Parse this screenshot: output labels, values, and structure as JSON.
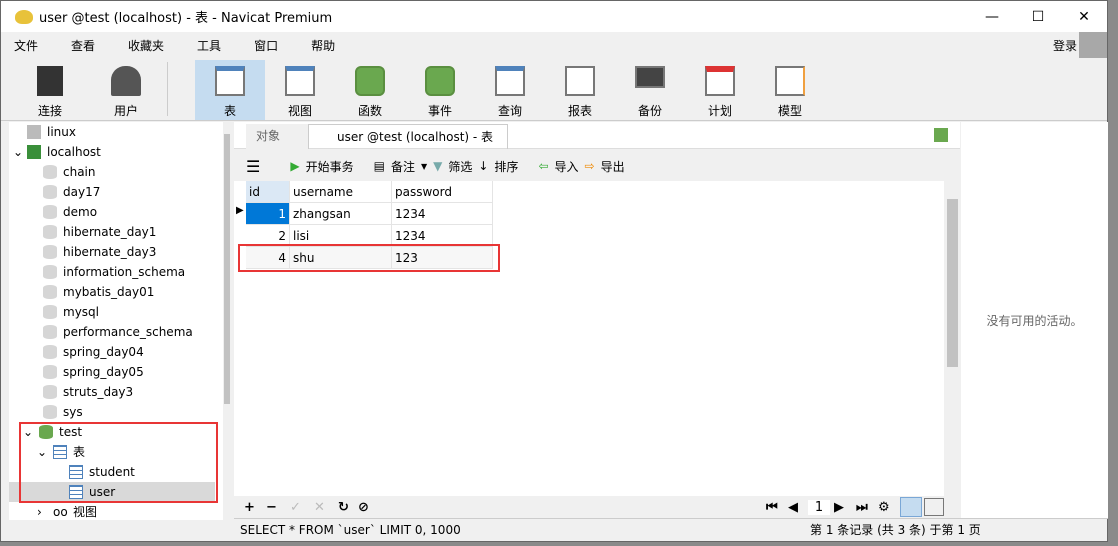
{
  "window": {
    "title": "user @test (localhost) - 表 - Navicat Premium",
    "minimize": "—",
    "maximize": "☐",
    "close": "✕"
  },
  "menu": [
    "文件",
    "查看",
    "收藏夹",
    "工具",
    "窗口",
    "帮助"
  ],
  "login": "登录",
  "toolbar": [
    {
      "label": "连接",
      "icon": "connection-icon"
    },
    {
      "label": "用户",
      "icon": "user-icon"
    },
    {
      "label": "表",
      "icon": "table-icon",
      "selected": true
    },
    {
      "label": "视图",
      "icon": "view-icon"
    },
    {
      "label": "函数",
      "icon": "function-icon"
    },
    {
      "label": "事件",
      "icon": "event-icon"
    },
    {
      "label": "查询",
      "icon": "query-icon"
    },
    {
      "label": "报表",
      "icon": "report-icon"
    },
    {
      "label": "备份",
      "icon": "backup-icon"
    },
    {
      "label": "计划",
      "icon": "schedule-icon"
    },
    {
      "label": "模型",
      "icon": "model-icon"
    }
  ],
  "tree": {
    "connections": [
      "linux",
      "localhost"
    ],
    "databases": [
      "chain",
      "day17",
      "demo",
      "hibernate_day1",
      "hibernate_day3",
      "information_schema",
      "mybatis_day01",
      "mysql",
      "performance_schema",
      "spring_day04",
      "spring_day05",
      "struts_day3",
      "sys",
      "test"
    ],
    "test_children": {
      "tables_label": "表",
      "tables": [
        "student",
        "user"
      ],
      "views_label": "视图"
    }
  },
  "tabs": {
    "objects": "对象",
    "active": "user @test (localhost) - 表"
  },
  "grid_toolbar": {
    "begin_transaction": "开始事务",
    "comment": "备注",
    "filter": "筛选",
    "sort": "排序",
    "import": "导入",
    "export": "导出"
  },
  "table": {
    "columns": [
      "id",
      "username",
      "password"
    ],
    "rows": [
      [
        "1",
        "zhangsan",
        "1234"
      ],
      [
        "2",
        "lisi",
        "1234"
      ],
      [
        "4",
        "shu",
        "123"
      ]
    ]
  },
  "pager": {
    "page": "1"
  },
  "status": {
    "sql": "SELECT * FROM `user` LIMIT 0, 1000",
    "record": "第 1 条记录 (共 3 条) 于第 1 页"
  },
  "right_panel": {
    "text": "没有可用的活动。"
  },
  "colors": {
    "highlight": "#e83535",
    "selection": "#0078d7"
  }
}
